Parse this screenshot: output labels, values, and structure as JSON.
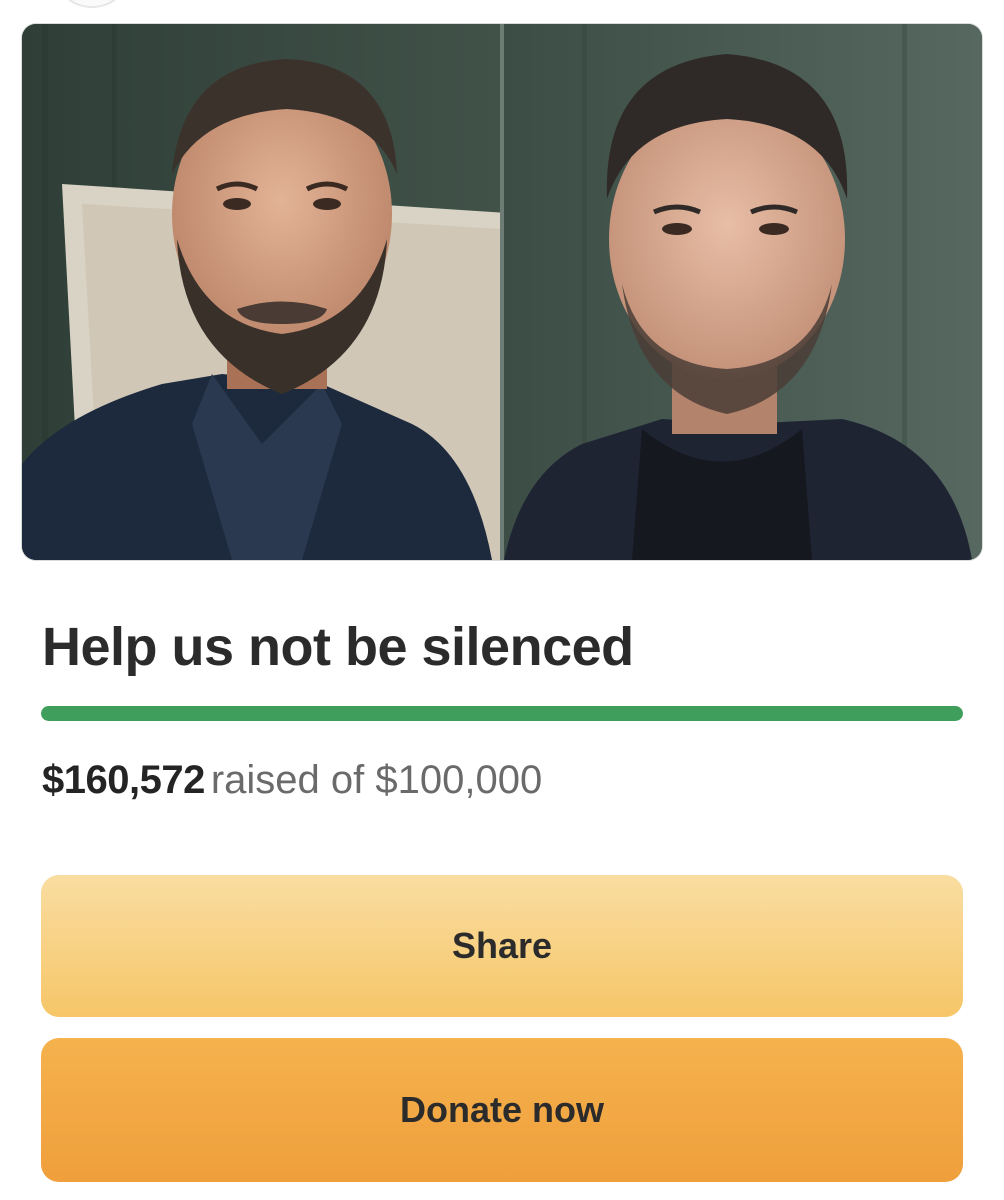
{
  "hero": {
    "image_description_name": "campaign-photo"
  },
  "campaign": {
    "title": "Help us not be silenced",
    "raised_amount": "$160,572",
    "raised_text": "raised of $100,000",
    "progress_fraction": 1.0
  },
  "actions": {
    "share_label": "Share",
    "donate_label": "Donate now"
  },
  "colors": {
    "progress": "#3f9e5b",
    "share_button": "#f7cd7a",
    "donate_button": "#f2a843",
    "text": "#2b2b2b"
  }
}
